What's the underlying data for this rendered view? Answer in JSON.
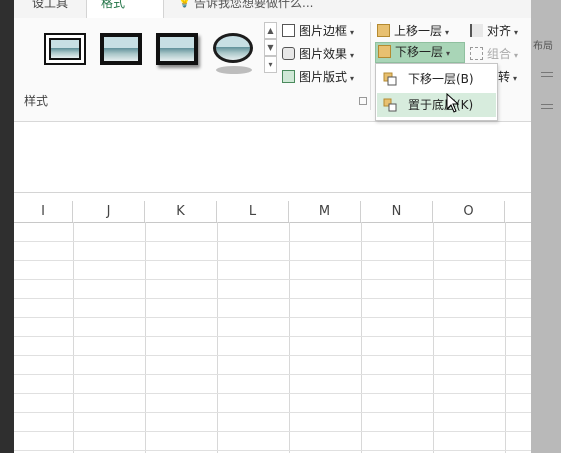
{
  "tabs": {
    "prev_tab": "设工具",
    "active_tab": "格式",
    "tell_me": "告诉我您想要做什么..."
  },
  "ribbon": {
    "picture_border": "图片边框",
    "picture_effects": "图片效果",
    "picture_layout": "图片版式",
    "styles_group_label": "样式",
    "bring_forward": "上移一层",
    "send_backward": "下移一层",
    "align": "对齐",
    "group": "组合",
    "rotate": "转"
  },
  "dropdown": {
    "send_backward_label": "下移一层(B)",
    "send_to_back_label": "置于底层(K)"
  },
  "sheet": {
    "columns": [
      "I",
      "J",
      "K",
      "L",
      "M",
      "N",
      "O"
    ]
  },
  "right_panel": {
    "label": "布局"
  },
  "colors": {
    "highlight": "#a9d5b7",
    "hover_item": "#d7ecdd",
    "frame": "#2f2f2f"
  }
}
